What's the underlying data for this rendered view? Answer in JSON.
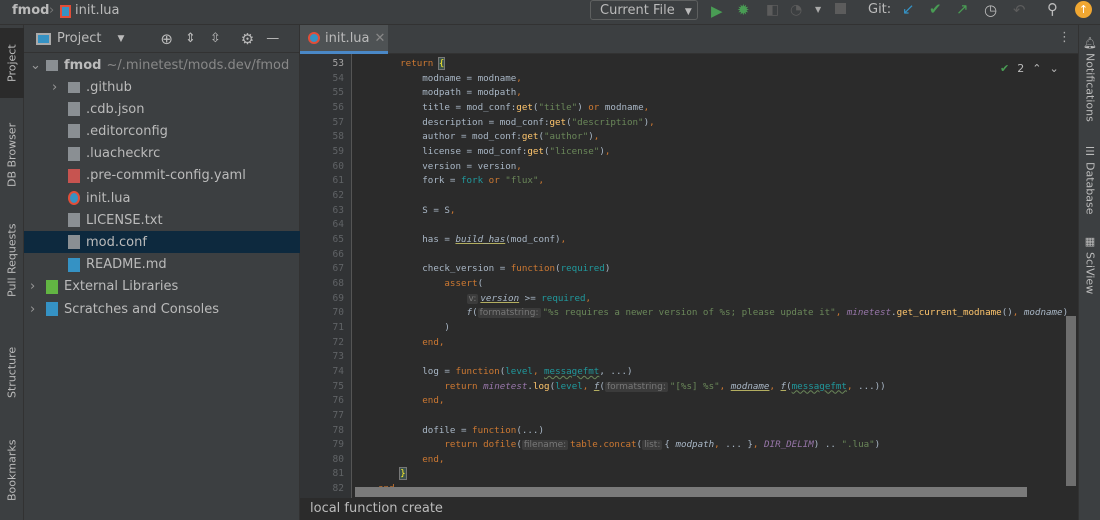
{
  "breadcrumb": {
    "project": "fmod",
    "file": "init.lua"
  },
  "toolbar": {
    "run_config": "Current File",
    "git_label": "Git:"
  },
  "left_strip": [
    "Project",
    "DB Browser",
    "Pull Requests",
    "Structure",
    "Bookmarks"
  ],
  "right_strip": [
    "Notifications",
    "Database",
    "SciView"
  ],
  "project_panel": {
    "title": "Project",
    "root": {
      "name": "fmod",
      "path": "~/.minetest/mods.dev/fmod"
    },
    "items": [
      {
        "label": ".github",
        "type": "folder",
        "depth": 1,
        "expandable": true
      },
      {
        "label": ".cdb.json",
        "type": "json",
        "depth": 1
      },
      {
        "label": ".editorconfig",
        "type": "config",
        "depth": 1
      },
      {
        "label": ".luacheckrc",
        "type": "text",
        "depth": 1
      },
      {
        "label": ".pre-commit-config.yaml",
        "type": "yaml",
        "depth": 1
      },
      {
        "label": "init.lua",
        "type": "lua",
        "depth": 1
      },
      {
        "label": "LICENSE.txt",
        "type": "text",
        "depth": 1
      },
      {
        "label": "mod.conf",
        "type": "text",
        "depth": 1,
        "selected": true
      },
      {
        "label": "README.md",
        "type": "md",
        "depth": 1
      },
      {
        "label": "External Libraries",
        "type": "libs",
        "depth": 0,
        "expandable": true
      },
      {
        "label": "Scratches and Consoles",
        "type": "scratch",
        "depth": 0,
        "expandable": true
      }
    ]
  },
  "editor": {
    "tab": "init.lua",
    "inspection_count": "2",
    "status_text": "local function create",
    "colors": {
      "keyword": "#cc7832",
      "string": "#6a8759",
      "function": "#ffc66d",
      "param": "#20999d",
      "global": "#9876aa",
      "text": "#a9b7c6"
    },
    "lines": [
      {
        "n": "53",
        "t": [
          [
            "    "
          ],
          [
            "return",
            "kw"
          ],
          [
            " "
          ],
          [
            "{",
            "brace"
          ]
        ]
      },
      {
        "n": "54",
        "t": [
          [
            "        modname = modname"
          ],
          [
            ",",
            "kw"
          ]
        ]
      },
      {
        "n": "55",
        "t": [
          [
            "        modpath = modpath"
          ],
          [
            ",",
            "kw"
          ]
        ]
      },
      {
        "n": "56",
        "t": [
          [
            "        title = mod_conf:"
          ],
          [
            "get",
            "fn"
          ],
          [
            "("
          ],
          [
            "\"title\"",
            "str"
          ],
          [
            ") "
          ],
          [
            "or",
            "kw"
          ],
          [
            " modname"
          ],
          [
            ",",
            "kw"
          ]
        ]
      },
      {
        "n": "57",
        "t": [
          [
            "        description = mod_conf:"
          ],
          [
            "get",
            "fn"
          ],
          [
            "("
          ],
          [
            "\"description\"",
            "str"
          ],
          [
            ")"
          ],
          [
            ",",
            "kw"
          ]
        ]
      },
      {
        "n": "58",
        "t": [
          [
            "        author = mod_conf:"
          ],
          [
            "get",
            "fn"
          ],
          [
            "("
          ],
          [
            "\"author\"",
            "str"
          ],
          [
            ")"
          ],
          [
            ",",
            "kw"
          ]
        ]
      },
      {
        "n": "59",
        "t": [
          [
            "        license = mod_conf:"
          ],
          [
            "get",
            "fn"
          ],
          [
            "("
          ],
          [
            "\"license\"",
            "str"
          ],
          [
            ")"
          ],
          [
            ",",
            "kw"
          ]
        ]
      },
      {
        "n": "60",
        "t": [
          [
            "        version = version"
          ],
          [
            ",",
            "kw"
          ]
        ]
      },
      {
        "n": "61",
        "t": [
          [
            "        fork = "
          ],
          [
            "fork",
            "param"
          ],
          [
            " "
          ],
          [
            "or",
            "kw"
          ],
          [
            " "
          ],
          [
            "\"flux\"",
            "str"
          ],
          [
            ",",
            "kw"
          ]
        ]
      },
      {
        "n": "62",
        "t": []
      },
      {
        "n": "63",
        "t": [
          [
            "        S = S"
          ],
          [
            ",",
            "kw"
          ]
        ]
      },
      {
        "n": "64",
        "t": []
      },
      {
        "n": "65",
        "t": [
          [
            "        has = "
          ],
          [
            "build_has",
            "it ul"
          ],
          [
            "(mod_conf)"
          ],
          [
            ",",
            "kw"
          ]
        ]
      },
      {
        "n": "66",
        "t": []
      },
      {
        "n": "67",
        "t": [
          [
            "        check_version = "
          ],
          [
            "function",
            "kw"
          ],
          [
            "("
          ],
          [
            "required",
            "param"
          ],
          [
            ")"
          ]
        ]
      },
      {
        "n": "68",
        "t": [
          [
            "            "
          ],
          [
            "assert",
            "kw"
          ],
          [
            "("
          ]
        ]
      },
      {
        "n": "69",
        "t": [
          [
            "                "
          ],
          [
            "v:",
            "hint"
          ],
          [
            "version",
            "it ul"
          ],
          [
            " >= "
          ],
          [
            "required",
            "param"
          ],
          [
            ",",
            "kw"
          ]
        ]
      },
      {
        "n": "70",
        "t": [
          [
            "                "
          ],
          [
            "f",
            "it"
          ],
          [
            "("
          ],
          [
            "formatstring:",
            "hint"
          ],
          [
            "\"%s requires a newer version of %s; please update it\"",
            "str"
          ],
          [
            ", ",
            "kw"
          ],
          [
            "minetest",
            "gl"
          ],
          [
            "."
          ],
          [
            "get_current_modname",
            "fn"
          ],
          [
            "()"
          ],
          [
            ", ",
            "kw"
          ],
          [
            "modname",
            "it"
          ],
          [
            ")"
          ]
        ]
      },
      {
        "n": "71",
        "t": [
          [
            "            )"
          ]
        ]
      },
      {
        "n": "72",
        "t": [
          [
            "        "
          ],
          [
            "end",
            "kw"
          ],
          [
            ",",
            "kw"
          ]
        ]
      },
      {
        "n": "73",
        "t": []
      },
      {
        "n": "74",
        "t": [
          [
            "        log = "
          ],
          [
            "function",
            "kw"
          ],
          [
            "("
          ],
          [
            "level",
            "param"
          ],
          [
            ", ",
            "kw"
          ],
          [
            "messagefmt",
            "param wv"
          ],
          [
            ", "
          ],
          [
            "...)"
          ]
        ]
      },
      {
        "n": "75",
        "t": [
          [
            "            "
          ],
          [
            "return",
            "kw"
          ],
          [
            " "
          ],
          [
            "minetest",
            "gl"
          ],
          [
            "."
          ],
          [
            "log",
            "fn"
          ],
          [
            "("
          ],
          [
            "level",
            "param"
          ],
          [
            ", ",
            "kw"
          ],
          [
            "f",
            "it ul"
          ],
          [
            "("
          ],
          [
            "formatstring:",
            "hint"
          ],
          [
            "\"[%s] %s\"",
            "str"
          ],
          [
            ", ",
            "kw"
          ],
          [
            "modname",
            "it ul"
          ],
          [
            ", ",
            "kw"
          ],
          [
            "f",
            "it ul"
          ],
          [
            "("
          ],
          [
            "messagefmt",
            "param wv"
          ],
          [
            ", ",
            "kw"
          ],
          [
            "...))"
          ]
        ]
      },
      {
        "n": "76",
        "t": [
          [
            "        "
          ],
          [
            "end",
            "kw"
          ],
          [
            ",",
            "kw"
          ]
        ]
      },
      {
        "n": "77",
        "t": []
      },
      {
        "n": "78",
        "t": [
          [
            "        dofile = "
          ],
          [
            "function",
            "kw"
          ],
          [
            "(...)"
          ]
        ]
      },
      {
        "n": "79",
        "t": [
          [
            "            "
          ],
          [
            "return",
            "kw"
          ],
          [
            " "
          ],
          [
            "dofile",
            "kw"
          ],
          [
            "("
          ],
          [
            "filename:",
            "hint"
          ],
          [
            "table.concat",
            "kw"
          ],
          [
            "("
          ],
          [
            "list:",
            "hint"
          ],
          [
            "{ "
          ],
          [
            "modpath",
            "it"
          ],
          [
            ", ",
            "kw"
          ],
          [
            "... }"
          ],
          [
            ", ",
            "kw"
          ],
          [
            "DIR_DELIM",
            "gl"
          ],
          [
            ") .. "
          ],
          [
            "\".lua\"",
            "str"
          ],
          [
            ")"
          ]
        ]
      },
      {
        "n": "80",
        "t": [
          [
            "        "
          ],
          [
            "end",
            "kw"
          ],
          [
            ",",
            "kw"
          ]
        ]
      },
      {
        "n": "81",
        "t": [
          [
            "    "
          ],
          [
            "}",
            "brace"
          ]
        ]
      },
      {
        "n": "82",
        "t": [
          [
            "end",
            "kw"
          ]
        ]
      }
    ]
  }
}
